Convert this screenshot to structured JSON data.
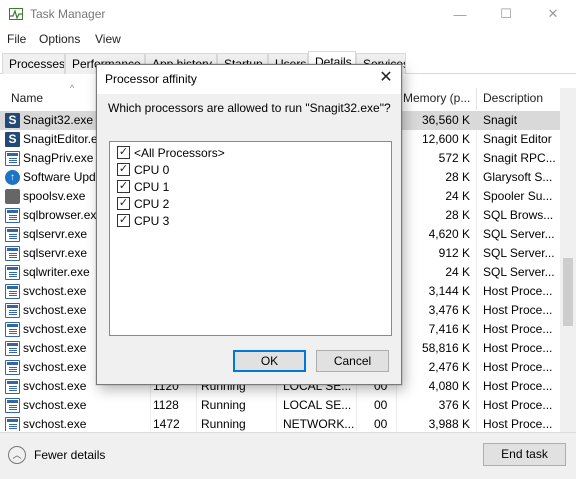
{
  "window": {
    "title": "Task Manager",
    "minimize": "—",
    "maximize": "☐",
    "close": "✕"
  },
  "menu": [
    "File",
    "Options",
    "View"
  ],
  "tabs": [
    "Processes",
    "Performance",
    "App history",
    "Startup",
    "Users",
    "Details",
    "Services"
  ],
  "columns": {
    "name": "Name",
    "memory": "Memory (p...",
    "description": "Description"
  },
  "rows": [
    {
      "icon": "snagit-icon",
      "name": "Snagit32.exe",
      "pid": "",
      "status": "",
      "user": "",
      "cpu": "",
      "memory": "36,560 K",
      "desc": "Snagit",
      "selected": true
    },
    {
      "icon": "snagit-icon",
      "name": "SnagitEditor.exe",
      "pid": "",
      "status": "",
      "user": "",
      "cpu": "",
      "memory": "12,600 K",
      "desc": "Snagit Editor",
      "selected": false
    },
    {
      "icon": "window-icon",
      "name": "SnagPriv.exe",
      "pid": "",
      "status": "",
      "user": "",
      "cpu": "",
      "memory": "572 K",
      "desc": "Snagit RPC...",
      "selected": false
    },
    {
      "icon": "update-icon",
      "name": "Software Updater.exe",
      "pid": "",
      "status": "",
      "user": "",
      "cpu": "",
      "memory": "28 K",
      "desc": "Glarysoft S...",
      "selected": false
    },
    {
      "icon": "printer-icon",
      "name": "spoolsv.exe",
      "pid": "",
      "status": "",
      "user": "",
      "cpu": "",
      "memory": "24 K",
      "desc": "Spooler Su...",
      "selected": false
    },
    {
      "icon": "window-icon",
      "name": "sqlbrowser.exe",
      "pid": "",
      "status": "",
      "user": "",
      "cpu": "",
      "memory": "28 K",
      "desc": "SQL Brows...",
      "selected": false
    },
    {
      "icon": "window-icon",
      "name": "sqlservr.exe",
      "pid": "",
      "status": "",
      "user": "",
      "cpu": "",
      "memory": "4,620 K",
      "desc": "SQL Server...",
      "selected": false
    },
    {
      "icon": "window-icon",
      "name": "sqlservr.exe",
      "pid": "",
      "status": "",
      "user": "",
      "cpu": "",
      "memory": "912 K",
      "desc": "SQL Server...",
      "selected": false
    },
    {
      "icon": "window-icon",
      "name": "sqlwriter.exe",
      "pid": "",
      "status": "",
      "user": "",
      "cpu": "",
      "memory": "24 K",
      "desc": "SQL Server...",
      "selected": false
    },
    {
      "icon": "window-icon",
      "name": "svchost.exe",
      "pid": "",
      "status": "",
      "user": "",
      "cpu": "",
      "memory": "3,144 K",
      "desc": "Host Proce...",
      "selected": false
    },
    {
      "icon": "window-icon",
      "name": "svchost.exe",
      "pid": "",
      "status": "",
      "user": "",
      "cpu": "",
      "memory": "3,476 K",
      "desc": "Host Proce...",
      "selected": false
    },
    {
      "icon": "window-icon",
      "name": "svchost.exe",
      "pid": "",
      "status": "",
      "user": "",
      "cpu": "",
      "memory": "7,416 K",
      "desc": "Host Proce...",
      "selected": false
    },
    {
      "icon": "window-icon",
      "name": "svchost.exe",
      "pid": "",
      "status": "",
      "user": "",
      "cpu": "",
      "memory": "58,816 K",
      "desc": "Host Proce...",
      "selected": false
    },
    {
      "icon": "window-icon",
      "name": "svchost.exe",
      "pid": "",
      "status": "",
      "user": "",
      "cpu": "",
      "memory": "2,476 K",
      "desc": "Host Proce...",
      "selected": false
    },
    {
      "icon": "window-icon",
      "name": "svchost.exe",
      "pid": "1120",
      "status": "Running",
      "user": "LOCAL SE...",
      "cpu": "00",
      "memory": "4,080 K",
      "desc": "Host Proce...",
      "selected": false
    },
    {
      "icon": "window-icon",
      "name": "svchost.exe",
      "pid": "1128",
      "status": "Running",
      "user": "LOCAL SE...",
      "cpu": "00",
      "memory": "376 K",
      "desc": "Host Proce...",
      "selected": false
    },
    {
      "icon": "window-icon",
      "name": "svchost.exe",
      "pid": "1472",
      "status": "Running",
      "user": "NETWORK...",
      "cpu": "00",
      "memory": "3,988 K",
      "desc": "Host Proce...",
      "selected": false
    }
  ],
  "footer": {
    "fewer_details": "Fewer details",
    "end_task": "End task"
  },
  "dialog": {
    "title": "Processor affinity",
    "close": "✕",
    "prompt": "Which processors are allowed to run \"Snagit32.exe\"?",
    "options": [
      {
        "label": "<All Processors>",
        "checked": true
      },
      {
        "label": "CPU 0",
        "checked": true
      },
      {
        "label": "CPU 1",
        "checked": true
      },
      {
        "label": "CPU 2",
        "checked": true
      },
      {
        "label": "CPU 3",
        "checked": true
      }
    ],
    "ok": "OK",
    "cancel": "Cancel"
  }
}
